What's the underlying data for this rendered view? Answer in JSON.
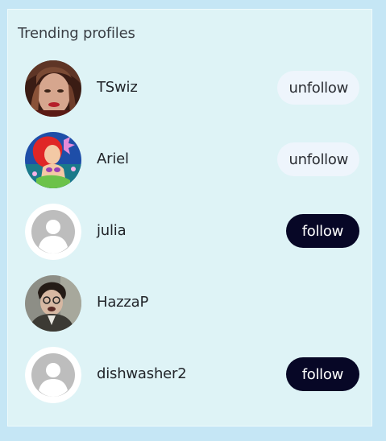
{
  "panel": {
    "title": "Trending profiles"
  },
  "profiles": [
    {
      "username": "TSwiz",
      "action_label": "unfollow",
      "avatar": "photo-red-lips"
    },
    {
      "username": "Ariel",
      "action_label": "unfollow",
      "avatar": "cartoon-mermaid"
    },
    {
      "username": "julia",
      "action_label": "follow",
      "avatar": "default-user-icon"
    },
    {
      "username": "HazzaP",
      "action_label": "",
      "avatar": "photo-boy-glasses"
    },
    {
      "username": "dishwasher2",
      "action_label": "follow",
      "avatar": "default-user-icon"
    }
  ],
  "colors": {
    "page_background": "#c5e6f5",
    "panel_background": "#def3f6",
    "follow_button": "#070726",
    "unfollow_button": "#eef5fc"
  }
}
